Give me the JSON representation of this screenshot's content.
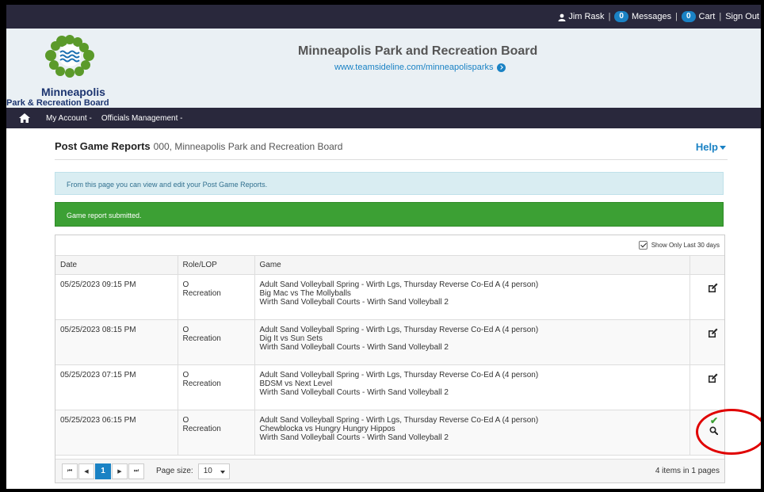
{
  "topbar": {
    "user_name": "Jim Rask",
    "messages_count": "0",
    "messages_label": "Messages",
    "cart_count": "0",
    "cart_label": "Cart",
    "signout_label": "Sign Out",
    "separator": "|"
  },
  "header": {
    "logo_line1": "Minneapolis",
    "logo_line2": "Park & Recreation Board",
    "org_title": "Minneapolis Park and Recreation Board",
    "org_url": "www.teamsideline.com/minneapolisparks"
  },
  "nav": {
    "items": [
      "My Account -",
      "Officials Management -"
    ]
  },
  "page": {
    "title": "Post Game Reports",
    "subtitle": "000, Minneapolis Park and Recreation Board",
    "help_label": "Help"
  },
  "alerts": {
    "info": "From this page you can view and edit your Post Game Reports.",
    "success": "Game report submitted."
  },
  "grid": {
    "filter_label": "Show Only Last 30 days",
    "columns": [
      "Date",
      "Role/LOP",
      "Game"
    ],
    "rows": [
      {
        "date": "05/25/2023 09:15 PM",
        "role": "O",
        "lop": "Recreation",
        "league": "Adult Sand Volleyball Spring - Wirth Lgs, Thursday Reverse Co-Ed A (4 person)",
        "matchup": "Big Mac vs The Mollyballs",
        "venue": "Wirth Sand Volleyball Courts - Wirth Sand Volleyball 2",
        "action": "edit"
      },
      {
        "date": "05/25/2023 08:15 PM",
        "role": "O",
        "lop": "Recreation",
        "league": "Adult Sand Volleyball Spring - Wirth Lgs, Thursday Reverse Co-Ed A (4 person)",
        "matchup": "Dig It vs Sun Sets",
        "venue": "Wirth Sand Volleyball Courts - Wirth Sand Volleyball 2",
        "action": "edit"
      },
      {
        "date": "05/25/2023 07:15 PM",
        "role": "O",
        "lop": "Recreation",
        "league": "Adult Sand Volleyball Spring - Wirth Lgs, Thursday Reverse Co-Ed A (4 person)",
        "matchup": "BDSM vs Next Level",
        "venue": "Wirth Sand Volleyball Courts - Wirth Sand Volleyball 2",
        "action": "edit"
      },
      {
        "date": "05/25/2023 06:15 PM",
        "role": "O",
        "lop": "Recreation",
        "league": "Adult Sand Volleyball Spring - Wirth Lgs, Thursday Reverse Co-Ed A (4 person)",
        "matchup": "Chewblocka vs Hungry Hungry Hippos",
        "venue": "Wirth Sand Volleyball Courts - Wirth Sand Volleyball 2",
        "action": "view"
      }
    ]
  },
  "pager": {
    "first": "⏮",
    "prev": "◀",
    "current_page": "1",
    "next": "▶",
    "last": "⏭",
    "page_size_label": "Page size:",
    "page_size": "10",
    "summary": "4 items in 1 pages"
  },
  "colors": {
    "top_bar": "#29283c",
    "link": "#1a82c4",
    "success": "#3ca034",
    "annotation": "#e00000"
  },
  "icons": [
    "user-icon",
    "go-icon",
    "home-icon",
    "caret-down-icon",
    "checkbox-checked-icon",
    "edit-icon",
    "check-icon",
    "search-icon"
  ]
}
